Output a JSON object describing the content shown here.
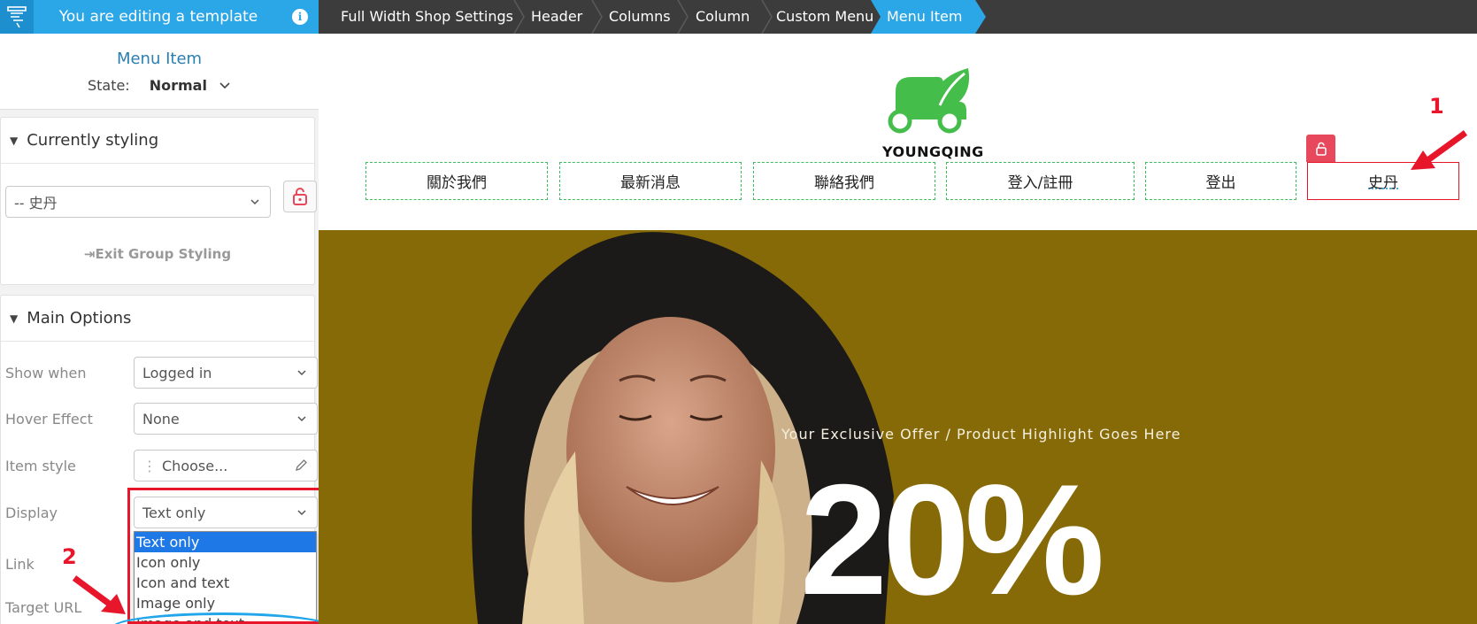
{
  "topbar": {
    "title": "You are editing a template",
    "info_icon": "info-icon"
  },
  "breadcrumb": [
    {
      "label": "Full Width Shop Settings"
    },
    {
      "label": "Header"
    },
    {
      "label": "Columns"
    },
    {
      "label": "Column"
    },
    {
      "label": "Custom Menu"
    },
    {
      "label": "Menu Item",
      "active": true
    }
  ],
  "panel": {
    "title": "Menu Item",
    "state_label": "State:",
    "state_value": "Normal"
  },
  "currently_styling": {
    "header": "Currently styling",
    "select_value": "-- 史丹",
    "exit_label": "Exit Group Styling"
  },
  "main_options": {
    "header": "Main Options",
    "show_when": {
      "label": "Show when",
      "value": "Logged in"
    },
    "hover_effect": {
      "label": "Hover Effect",
      "value": "None"
    },
    "item_style": {
      "label": "Item style",
      "value": "Choose..."
    },
    "display": {
      "label": "Display",
      "value": "Text only",
      "options": [
        "Text only",
        "Icon only",
        "Icon and text",
        "Image only",
        "Image and text"
      ]
    },
    "link": {
      "label": "Link"
    },
    "target_url": {
      "label": "Target URL"
    }
  },
  "annotations": {
    "one": "1",
    "two": "2"
  },
  "site": {
    "brand": "YOUNGQING",
    "menu": [
      "關於我們",
      "最新消息",
      "聯絡我們",
      "登入/註冊",
      "登出",
      "史丹"
    ]
  },
  "hero": {
    "tagline": "Your Exclusive Offer / Product Highlight Goes Here",
    "big_text": "20%"
  },
  "colors": {
    "accent": "#2ba6e6",
    "breadcrumb_bg": "#3c3c3c",
    "annotation_red": "#e8162b",
    "brand_green": "#3bbf5c",
    "hero_bg": "#876a08"
  }
}
